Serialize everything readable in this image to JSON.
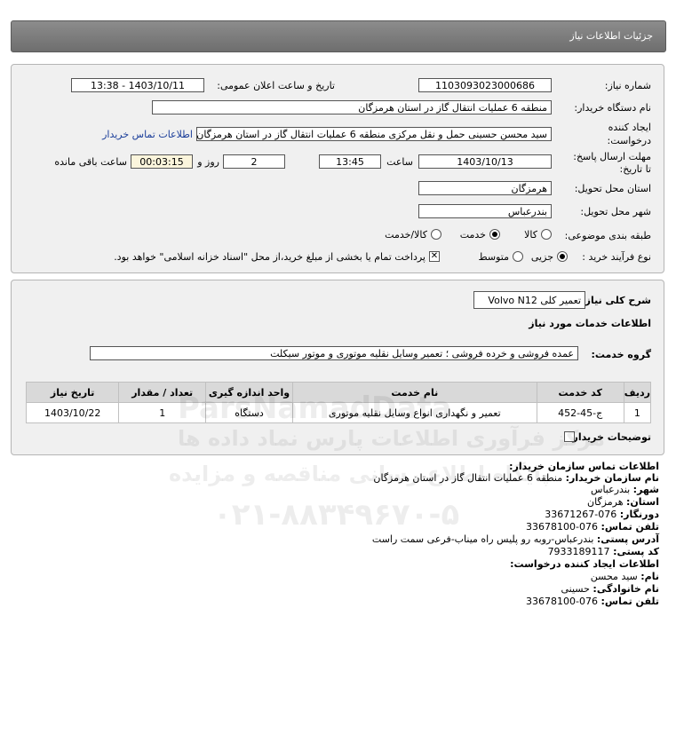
{
  "header": {
    "title": "جزئیات اطلاعات نیاز"
  },
  "form": {
    "need_number_label": "شماره نیاز:",
    "need_number": "1103093023000686",
    "announce_label": "تاریخ و ساعت اعلان عمومی:",
    "announce_value": "1403/10/11 - 13:38",
    "buyer_org_label": "نام دستگاه خریدار:",
    "buyer_org": "منطقه 6 عملیات انتقال گاز در استان هرمزگان",
    "requester_label_1": "ایجاد کننده",
    "requester_label_2": "درخواست:",
    "requester": "سید محسن حسینی حمل و نقل مرکزی منطقه 6 عملیات انتقال گاز در استان هرمزگان",
    "buyer_contact_link": "اطلاعات تماس خریدار",
    "deadline_label_1": "مهلت ارسال پاسخ:",
    "deadline_label_2": "تا تاریخ:",
    "deadline_date": "1403/10/13",
    "time_label": "ساعت",
    "deadline_time": "13:45",
    "days_value": "2",
    "days_label": "روز و",
    "remaining_time": "00:03:15",
    "remaining_label": "ساعت باقی مانده",
    "province_label": "استان محل تحویل:",
    "province": "هرمزگان",
    "city_label": "شهر محل تحویل:",
    "city": "بندرعباس",
    "category_label": "طبقه بندی موضوعی:",
    "category_options": [
      "کالا",
      "خدمت",
      "کالا/خدمت"
    ],
    "category_selected": "خدمت",
    "process_label": "نوع فرآیند خرید :",
    "process_options": [
      "جزیی",
      "متوسط"
    ],
    "process_selected": "جزیی",
    "payment_note": "پرداخت تمام یا بخشی از مبلغ خرید،از محل \"اسناد خزانه اسلامی\" خواهد بود."
  },
  "need": {
    "description_label": "شرح کلی نیاز:",
    "description": "تعمیر کلی Volvo N12",
    "services_title": "اطلاعات خدمات مورد نیاز",
    "service_group_label": "گروه خدمت:",
    "service_group": "عمده فروشی و خرده فروشی ؛ تعمیر وسایل نقلیه موتوری و موتور سیکلت",
    "table": {
      "headers": [
        "ردیف",
        "کد خدمت",
        "نام خدمت",
        "واحد اندازه گیری",
        "تعداد / مقدار",
        "تاریخ نیاز"
      ],
      "rows": [
        [
          "1",
          "ج-45-452",
          "تعمیر و نگهداری انواع وسایل نقلیه موتوری",
          "دستگاه",
          "1",
          "1403/10/22"
        ]
      ]
    },
    "buyer_notes_label": "توضیحات خریدار:"
  },
  "contact": {
    "title": "اطلاعات تماس سازمان خریدار:",
    "org_label": "نام سازمان خریدار:",
    "org": "منطقه 6 عملیات انتقال گاز در استان هرمزگان",
    "city_label": "شهر:",
    "city": "بندرعباس",
    "province_label": "استان:",
    "province": "هرمزگان",
    "fax_label": "دورنگار:",
    "fax": "076-33671267",
    "phone_label": "تلفن تماس:",
    "phone": "076-33678100",
    "address_label": "آدرس پستی:",
    "address": "بندرعباس-روبه رو پلیس راه میناب-فرعی سمت راست",
    "postal_label": "کد پستی:",
    "postal": "7933189117",
    "creator_title": "اطلاعات ایجاد کننده درخواست:",
    "first_name_label": "نام:",
    "first_name": "سید محسن",
    "last_name_label": "نام خانوادگی:",
    "last_name": "حسینی",
    "creator_phone_label": "تلفن تماس:",
    "creator_phone": "076-33678100"
  },
  "watermark": {
    "line1": "ParsNamadData",
    "line2": "مرکز فرآوری اطلاعات پارس نماد داده ها",
    "line3": "پایگاه اطلاع رسانی مناقصه و مزایده",
    "line4": "۰۲۱-۸۸۳۴۹۶۷۰-۵"
  }
}
